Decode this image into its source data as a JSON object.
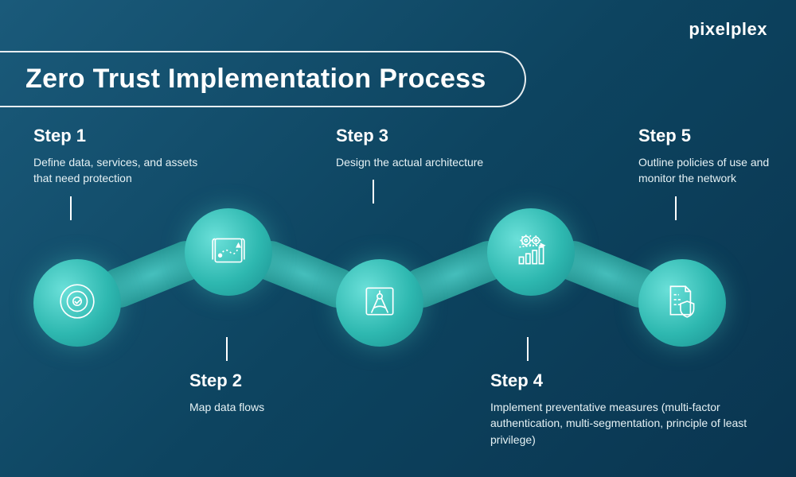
{
  "brand": "pixelplex",
  "title": "Zero Trust Implementation Process",
  "steps": [
    {
      "label": "Step 1",
      "desc": "Define data, services, and assets that need protection",
      "icon": "target-check"
    },
    {
      "label": "Step 2",
      "desc": "Map data flows",
      "icon": "map-route"
    },
    {
      "label": "Step 3",
      "desc": "Design the actual architecture",
      "icon": "compass-blueprint"
    },
    {
      "label": "Step 4",
      "desc": "Implement preventative measures (multi-factor authentication, multi-segmentation, principle of least privilege)",
      "icon": "gears-barchart"
    },
    {
      "label": "Step 5",
      "desc": "Outline policies of use and monitor the network",
      "icon": "document-shield"
    }
  ]
}
